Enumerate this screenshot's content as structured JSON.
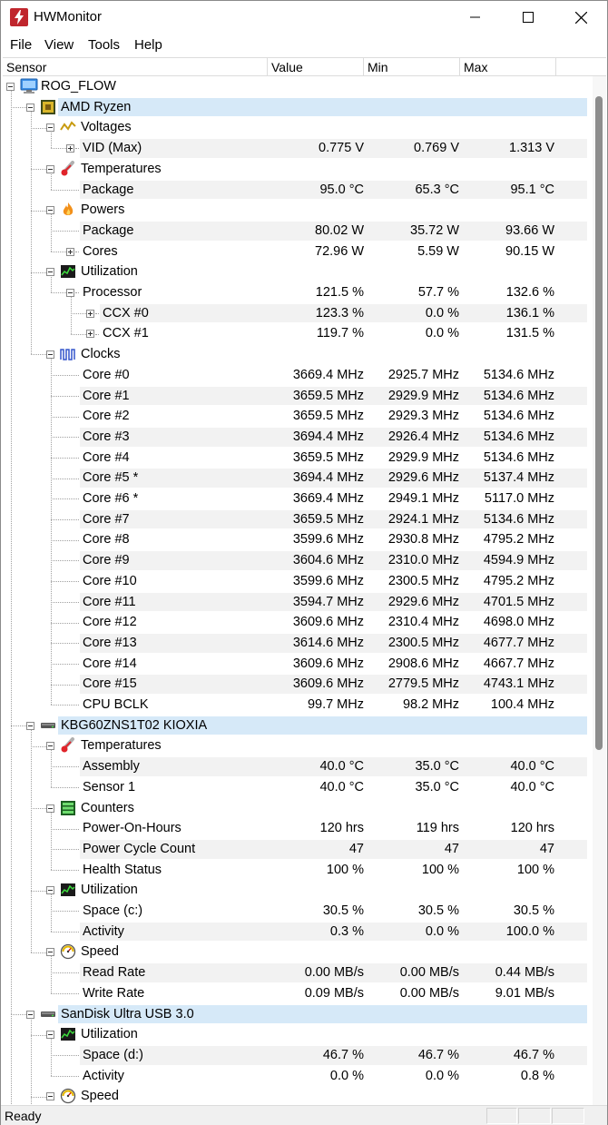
{
  "window": {
    "title": "HWMonitor",
    "icon": "lightning-bolt-icon",
    "controls": [
      "minimize-icon",
      "maximize-icon",
      "close-icon"
    ]
  },
  "menu": [
    "File",
    "View",
    "Tools",
    "Help"
  ],
  "columns": {
    "sensor": "Sensor",
    "value": "Value",
    "min": "Min",
    "max": "Max"
  },
  "tree": [
    {
      "level": 0,
      "label": "ROG_FLOW",
      "icon": "computer-icon",
      "expander": "minus"
    },
    {
      "level": 1,
      "label": "AMD Ryzen",
      "icon": "cpu-chip-icon",
      "expander": "minus",
      "selected": true
    },
    {
      "level": 2,
      "label": "Voltages",
      "icon": "voltage-icon",
      "expander": "minus"
    },
    {
      "level": 3,
      "label": "VID (Max)",
      "expander": "plus",
      "value": "0.775 V",
      "min": "0.769 V",
      "max": "1.313 V"
    },
    {
      "level": 2,
      "label": "Temperatures",
      "icon": "thermometer-icon",
      "expander": "minus"
    },
    {
      "level": 3,
      "label": "Package",
      "value": "95.0 °C",
      "min": "65.3 °C",
      "max": "95.1 °C"
    },
    {
      "level": 2,
      "label": "Powers",
      "icon": "flame-icon",
      "expander": "minus"
    },
    {
      "level": 3,
      "label": "Package",
      "value": "80.02 W",
      "min": "35.72 W",
      "max": "93.66 W"
    },
    {
      "level": 3,
      "label": "Cores",
      "expander": "plus",
      "value": "72.96 W",
      "min": "5.59 W",
      "max": "90.15 W"
    },
    {
      "level": 2,
      "label": "Utilization",
      "icon": "utilization-graph-icon",
      "expander": "minus"
    },
    {
      "level": 3,
      "label": "Processor",
      "expander": "minus",
      "value": "121.5 %",
      "min": "57.7 %",
      "max": "132.6 %"
    },
    {
      "level": 4,
      "label": "CCX #0",
      "expander": "plus",
      "value": "123.3 %",
      "min": "0.0 %",
      "max": "136.1 %"
    },
    {
      "level": 4,
      "label": "CCX #1",
      "expander": "plus",
      "value": "119.7 %",
      "min": "0.0 %",
      "max": "131.5 %"
    },
    {
      "level": 2,
      "label": "Clocks",
      "icon": "clock-wave-icon",
      "expander": "minus"
    },
    {
      "level": 3,
      "label": "Core #0",
      "value": "3669.4 MHz",
      "min": "2925.7 MHz",
      "max": "5134.6 MHz"
    },
    {
      "level": 3,
      "label": "Core #1",
      "value": "3659.5 MHz",
      "min": "2929.9 MHz",
      "max": "5134.6 MHz"
    },
    {
      "level": 3,
      "label": "Core #2",
      "value": "3659.5 MHz",
      "min": "2929.3 MHz",
      "max": "5134.6 MHz"
    },
    {
      "level": 3,
      "label": "Core #3",
      "value": "3694.4 MHz",
      "min": "2926.4 MHz",
      "max": "5134.6 MHz"
    },
    {
      "level": 3,
      "label": "Core #4",
      "value": "3659.5 MHz",
      "min": "2929.9 MHz",
      "max": "5134.6 MHz"
    },
    {
      "level": 3,
      "label": "Core #5 *",
      "value": "3694.4 MHz",
      "min": "2929.6 MHz",
      "max": "5137.4 MHz"
    },
    {
      "level": 3,
      "label": "Core #6 *",
      "value": "3669.4 MHz",
      "min": "2949.1 MHz",
      "max": "5117.0 MHz"
    },
    {
      "level": 3,
      "label": "Core #7",
      "value": "3659.5 MHz",
      "min": "2924.1 MHz",
      "max": "5134.6 MHz"
    },
    {
      "level": 3,
      "label": "Core #8",
      "value": "3599.6 MHz",
      "min": "2930.8 MHz",
      "max": "4795.2 MHz"
    },
    {
      "level": 3,
      "label": "Core #9",
      "value": "3604.6 MHz",
      "min": "2310.0 MHz",
      "max": "4594.9 MHz"
    },
    {
      "level": 3,
      "label": "Core #10",
      "value": "3599.6 MHz",
      "min": "2300.5 MHz",
      "max": "4795.2 MHz"
    },
    {
      "level": 3,
      "label": "Core #11",
      "value": "3594.7 MHz",
      "min": "2929.6 MHz",
      "max": "4701.5 MHz"
    },
    {
      "level": 3,
      "label": "Core #12",
      "value": "3609.6 MHz",
      "min": "2310.4 MHz",
      "max": "4698.0 MHz"
    },
    {
      "level": 3,
      "label": "Core #13",
      "value": "3614.6 MHz",
      "min": "2300.5 MHz",
      "max": "4677.7 MHz"
    },
    {
      "level": 3,
      "label": "Core #14",
      "value": "3609.6 MHz",
      "min": "2908.6 MHz",
      "max": "4667.7 MHz"
    },
    {
      "level": 3,
      "label": "Core #15",
      "value": "3609.6 MHz",
      "min": "2779.5 MHz",
      "max": "4743.1 MHz"
    },
    {
      "level": 3,
      "label": "CPU BCLK",
      "value": "99.7 MHz",
      "min": "98.2 MHz",
      "max": "100.4 MHz"
    },
    {
      "level": 1,
      "label": "KBG60ZNS1T02 KIOXIA",
      "icon": "drive-icon",
      "expander": "minus",
      "selected": true
    },
    {
      "level": 2,
      "label": "Temperatures",
      "icon": "thermometer-icon",
      "expander": "minus"
    },
    {
      "level": 3,
      "label": "Assembly",
      "value": "40.0 °C",
      "min": "35.0 °C",
      "max": "40.0 °C"
    },
    {
      "level": 3,
      "label": "Sensor 1",
      "value": "40.0 °C",
      "min": "35.0 °C",
      "max": "40.0 °C"
    },
    {
      "level": 2,
      "label": "Counters",
      "icon": "counter-bars-icon",
      "expander": "minus"
    },
    {
      "level": 3,
      "label": "Power-On-Hours",
      "value": "120 hrs",
      "min": "119 hrs",
      "max": "120 hrs"
    },
    {
      "level": 3,
      "label": "Power Cycle Count",
      "value": "47",
      "min": "47",
      "max": "47"
    },
    {
      "level": 3,
      "label": "Health Status",
      "value": "100 %",
      "min": "100 %",
      "max": "100 %"
    },
    {
      "level": 2,
      "label": "Utilization",
      "icon": "utilization-graph-icon",
      "expander": "minus"
    },
    {
      "level": 3,
      "label": "Space (c:)",
      "value": "30.5 %",
      "min": "30.5 %",
      "max": "30.5 %"
    },
    {
      "level": 3,
      "label": "Activity",
      "value": "0.3 %",
      "min": "0.0 %",
      "max": "100.0 %"
    },
    {
      "level": 2,
      "label": "Speed",
      "icon": "speedometer-icon",
      "expander": "minus"
    },
    {
      "level": 3,
      "label": "Read Rate",
      "value": "0.00 MB/s",
      "min": "0.00 MB/s",
      "max": "0.44 MB/s"
    },
    {
      "level": 3,
      "label": "Write Rate",
      "value": "0.09 MB/s",
      "min": "0.00 MB/s",
      "max": "9.01 MB/s"
    },
    {
      "level": 1,
      "label": "SanDisk Ultra USB 3.0",
      "icon": "drive-icon",
      "expander": "minus",
      "selected": true
    },
    {
      "level": 2,
      "label": "Utilization",
      "icon": "utilization-graph-icon",
      "expander": "minus"
    },
    {
      "level": 3,
      "label": "Space (d:)",
      "value": "46.7 %",
      "min": "46.7 %",
      "max": "46.7 %"
    },
    {
      "level": 3,
      "label": "Activity",
      "value": "0.0 %",
      "min": "0.0 %",
      "max": "0.8 %"
    },
    {
      "level": 2,
      "label": "Speed",
      "icon": "speedometer-icon",
      "expander": "minus"
    }
  ],
  "status": {
    "text": "Ready"
  },
  "colors": {
    "selected_row": "#d6e9f8",
    "alt_row": "#f2f2f2",
    "accent": "#c0262d"
  }
}
